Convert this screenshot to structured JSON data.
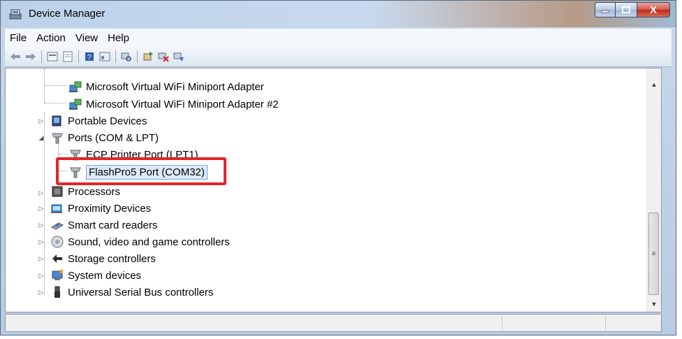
{
  "window": {
    "title": "Device Manager",
    "close_glyph": "X"
  },
  "menu": [
    "File",
    "Action",
    "View",
    "Help"
  ],
  "toolbar": {
    "icons": [
      "back-icon",
      "forward-icon",
      "properties-icon",
      "list-icon",
      "help-icon",
      "view-icon",
      "scan-hardware-icon",
      "update-driver-icon",
      "uninstall-icon",
      "disable-icon"
    ]
  },
  "tree": {
    "items": [
      {
        "label": "Microsoft Virtual WiFi Miniport Adapter",
        "icon": "network-adapter-icon"
      },
      {
        "label": "Microsoft Virtual WiFi Miniport Adapter #2",
        "icon": "network-adapter-icon"
      },
      {
        "label": "Portable Devices",
        "icon": "portable-device-icon",
        "expander": "▷"
      },
      {
        "label": "Ports (COM & LPT)",
        "icon": "port-icon",
        "expander": "◢"
      },
      {
        "label": "ECP Printer Port (LPT1)",
        "icon": "port-icon"
      },
      {
        "label": "FlashPro5 Port (COM32)",
        "icon": "port-icon",
        "selected": true
      },
      {
        "label": "Processors",
        "icon": "processor-icon",
        "expander": "▷"
      },
      {
        "label": "Proximity Devices",
        "icon": "proximity-icon",
        "expander": "▷"
      },
      {
        "label": "Smart card readers",
        "icon": "smart-card-icon",
        "expander": "▷"
      },
      {
        "label": "Sound, video and game controllers",
        "icon": "sound-icon",
        "expander": "▷"
      },
      {
        "label": "Storage controllers",
        "icon": "storage-icon",
        "expander": "▷"
      },
      {
        "label": "System devices",
        "icon": "system-icon",
        "expander": "▷"
      },
      {
        "label": "Universal Serial Bus controllers",
        "icon": "usb-icon",
        "expander": "▷"
      }
    ]
  },
  "scrollbar": {
    "up_glyph": "▲",
    "down_glyph": "▼",
    "grip_glyph": "≡"
  },
  "colors": {
    "highlight_box": "#e3262b",
    "selection": "#dcebfc"
  }
}
